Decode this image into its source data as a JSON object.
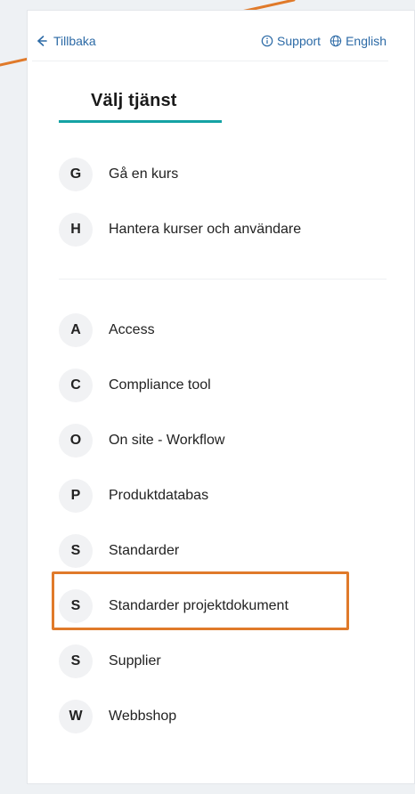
{
  "topbar": {
    "back_label": "Tillbaka",
    "support_label": "Support",
    "language_label": "English"
  },
  "title": "Välj tjänst",
  "groups": [
    {
      "items": [
        {
          "letter": "G",
          "label": "Gå en kurs"
        },
        {
          "letter": "H",
          "label": "Hantera kurser och användare"
        }
      ]
    },
    {
      "items": [
        {
          "letter": "A",
          "label": "Access"
        },
        {
          "letter": "C",
          "label": "Compliance tool"
        },
        {
          "letter": "O",
          "label": "On site - Workflow"
        },
        {
          "letter": "P",
          "label": "Produktdatabas"
        },
        {
          "letter": "S",
          "label": "Standarder"
        },
        {
          "letter": "S",
          "label": "Standarder projektdokument"
        },
        {
          "letter": "S",
          "label": "Supplier"
        },
        {
          "letter": "W",
          "label": "Webbshop"
        }
      ]
    }
  ],
  "colors": {
    "accent": "#14a2a4",
    "highlight": "#e07a2a",
    "link": "#2c6aa6"
  }
}
